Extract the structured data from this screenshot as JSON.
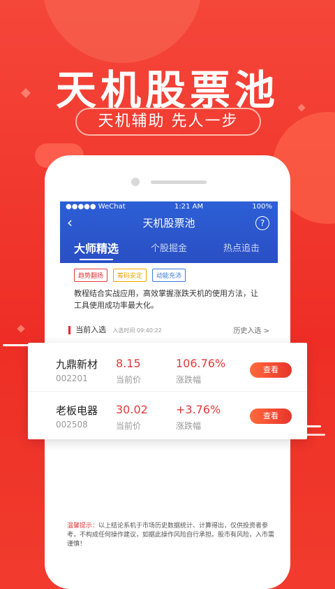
{
  "hero": {
    "title": "天机股票池",
    "slogan": "天机辅助 先人一步"
  },
  "status_bar": {
    "carrier": "●●●●● WeChat",
    "time": "1:21 AM",
    "battery": "100%"
  },
  "app": {
    "title": "天机股票池",
    "back_icon": "chevron-left-icon",
    "help_icon": "question-icon",
    "tabs": [
      {
        "label": "大师精选"
      },
      {
        "label": "个股掘金"
      },
      {
        "label": "热点追击"
      }
    ],
    "tags": [
      {
        "label": "趋势翻扬",
        "color": "#e2393b"
      },
      {
        "label": "筹码安定",
        "color": "#f0a500"
      },
      {
        "label": "动能充沛",
        "color": "#3a7bd5"
      }
    ],
    "description": "教程结合实战应用，高效掌握涨跌天机的使用方法，让工具使用成功率最大化。",
    "section": {
      "label": "当前入选",
      "time_label": "入选时间 09:40:22",
      "history": "历史入选 >"
    }
  },
  "stocks": [
    {
      "name": "九鼎新材",
      "code": "002201",
      "price": "8.15",
      "price_label": "当前价",
      "change": "106.76%",
      "change_label": "涨跌幅",
      "button": "查看"
    },
    {
      "name": "老板电器",
      "code": "002508",
      "price": "30.02",
      "price_label": "当前价",
      "change": "+3.76%",
      "change_label": "涨跌幅",
      "button": "查看"
    }
  ],
  "notice": {
    "prefix": "温馨提示：",
    "text": "以上结论系机于市场历史数据统计、计算得出，仅供投资者参考，不构成任何操作建议，如据此操作风险自行承担。股市有风险，入市需谨慎！"
  },
  "colors": {
    "accent_red": "#e2393b",
    "app_blue": "#2d5fd6",
    "background_red": "#f23a2f"
  }
}
